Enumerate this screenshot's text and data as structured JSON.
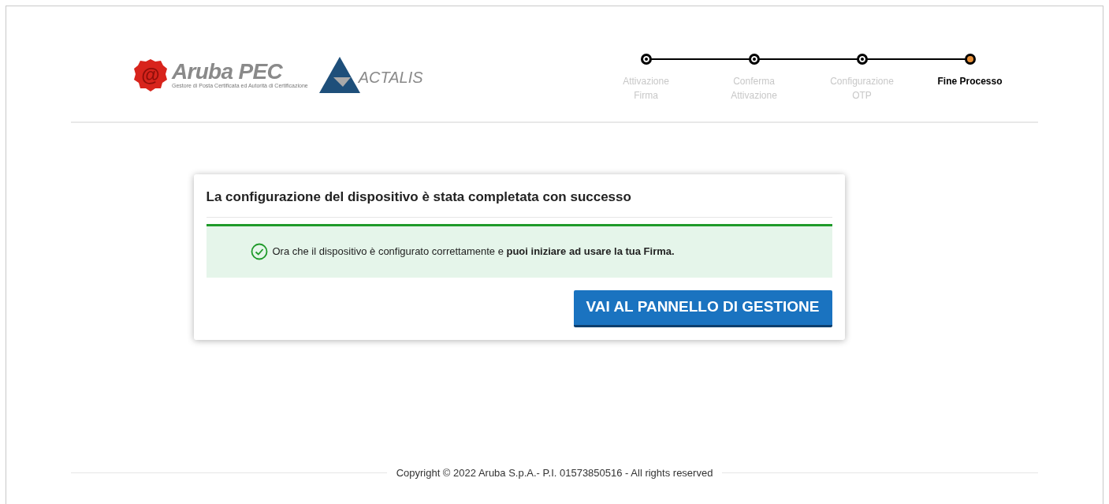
{
  "header": {
    "logo": {
      "seal": "@",
      "name": "Aruba PEC",
      "tagline": "Gestore di Posta Certificata ed Autorità di Certificazione"
    },
    "partner_logo": {
      "name": "ACTALIS"
    }
  },
  "steps": [
    {
      "label": "Attivazione Firma",
      "selected": false
    },
    {
      "label": "Conferma Attivazione",
      "selected": false
    },
    {
      "label": "Configurazione OTP",
      "selected": false
    },
    {
      "label": "Fine Processo",
      "selected": true
    }
  ],
  "card": {
    "title": "La configurazione del dispositivo è stata completata con successo",
    "message": "Ora che il dispositivo è configurato correttamente e **puoi iniziare ad usare la tua Firma.**",
    "button": "VAI AL PANNELLO DI GESTIONE"
  },
  "footer": {
    "copyright": "Copyright © 2022 Aruba S.p.A.- P.I. 01573850516 - All rights reserved"
  }
}
